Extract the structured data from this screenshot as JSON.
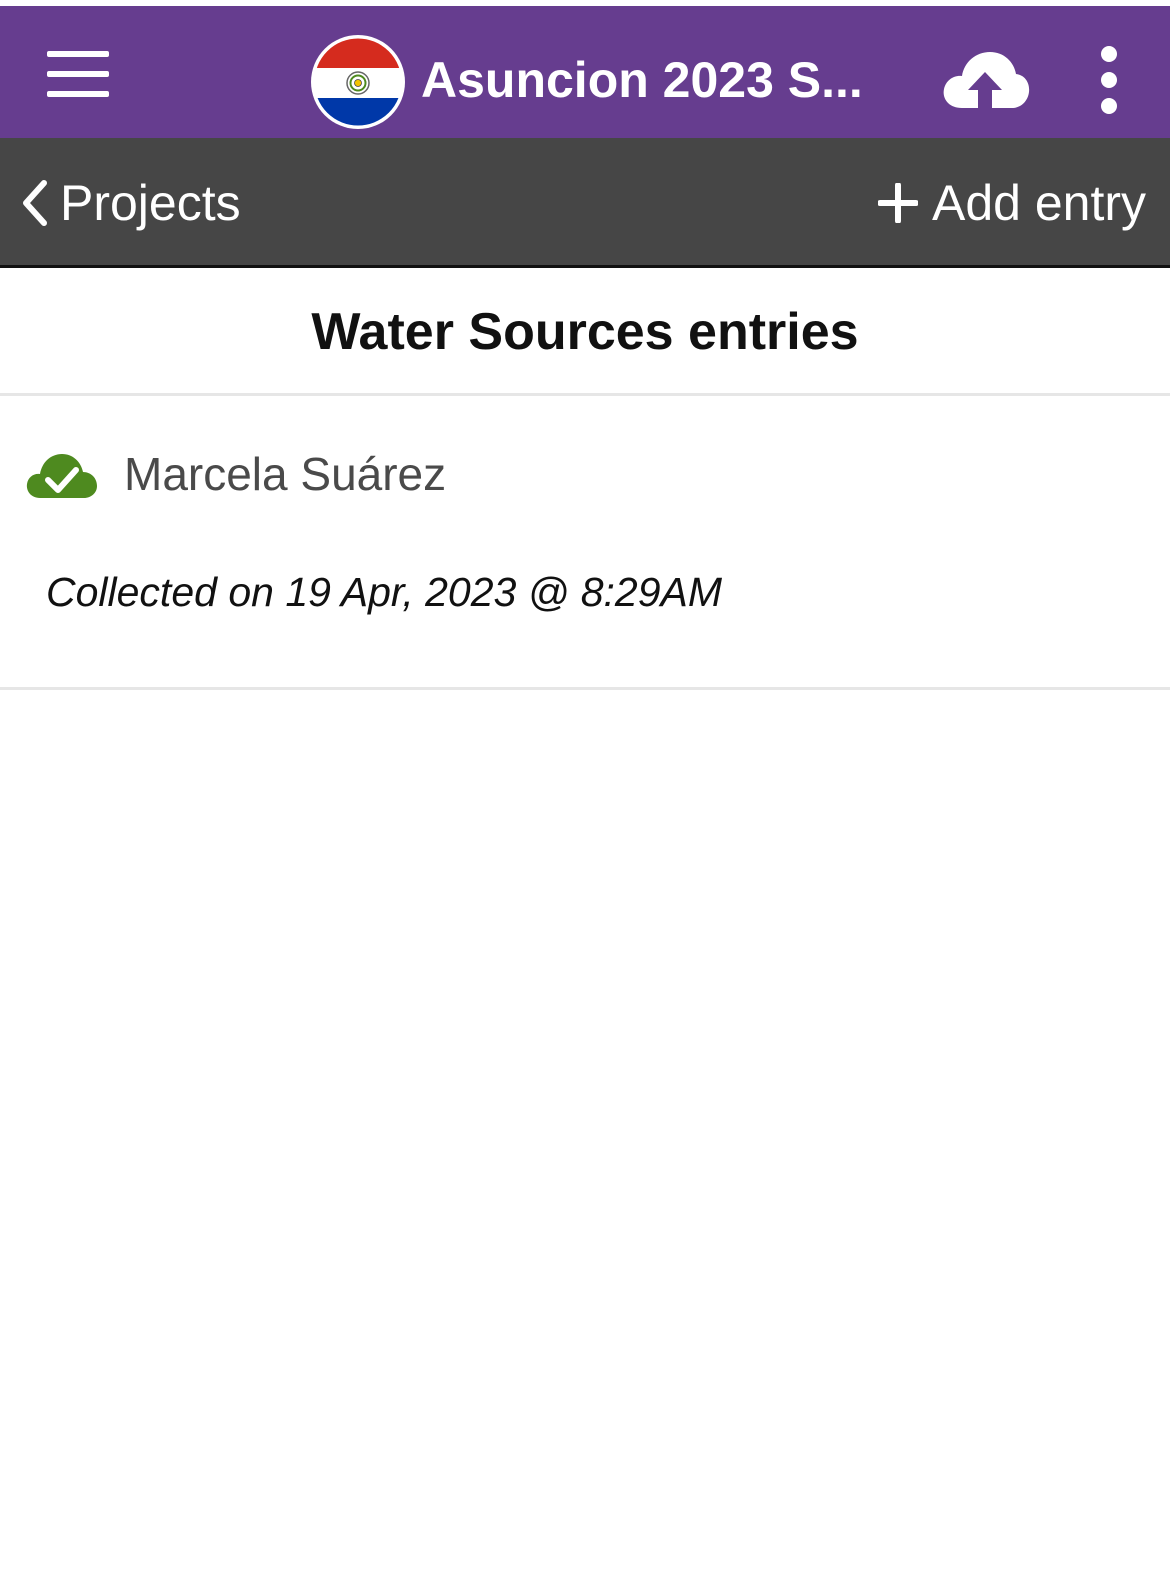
{
  "appbar": {
    "title": "Asuncion 2023 S...",
    "background_color": "#663d8f",
    "menu_icon": "hamburger-menu-icon",
    "logo_icon": "paraguay-flag-logo",
    "upload_icon": "cloud-upload-icon",
    "more_icon": "more-vertical-icon"
  },
  "navbar": {
    "back_label": "Projects",
    "add_label": "Add entry",
    "background_color": "#464646"
  },
  "list": {
    "title": "Water Sources entries",
    "entries": [
      {
        "name": "Marcela Suárez",
        "collected": "Collected on 19 Apr, 2023 @ 8:29AM",
        "status_icon": "cloud-check-icon",
        "status_color": "#4e8a1f"
      }
    ]
  }
}
